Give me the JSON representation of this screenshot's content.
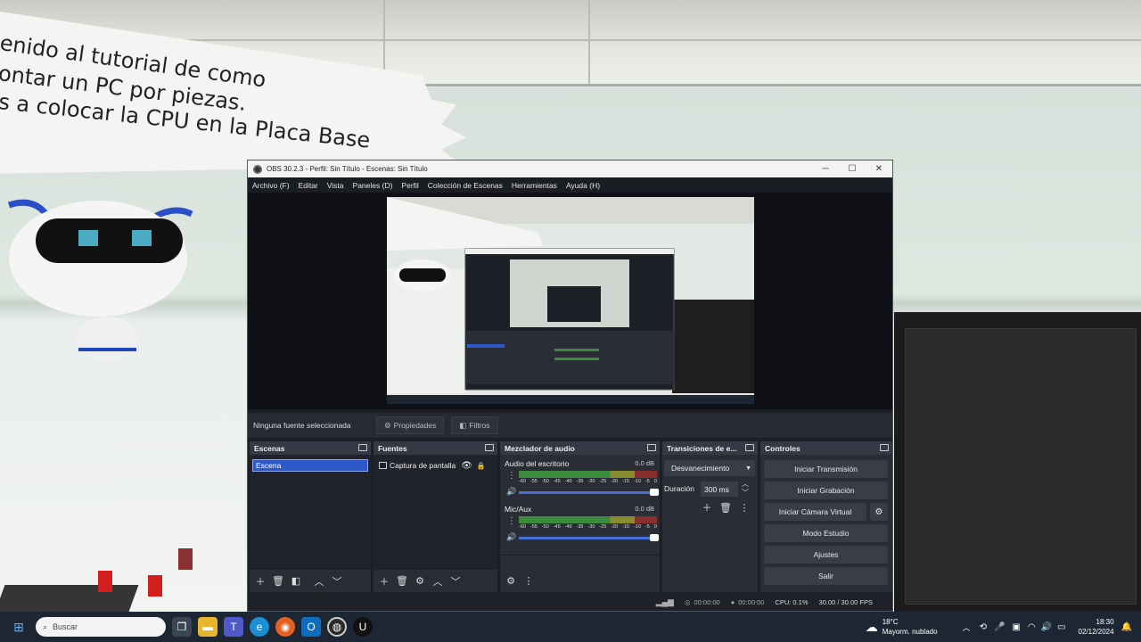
{
  "window": {
    "title": "OBS 30.2.3 - Perfil: Sin Título - Escenas: Sin Título"
  },
  "background": {
    "banner_lines": [
      "enido al tutorial de como",
      "ontar un PC por piezas.",
      "s a colocar la CPU en la Placa Base"
    ]
  },
  "menu": [
    "Archivo (F)",
    "Editar",
    "Vista",
    "Paneles (D)",
    "Perfil",
    "Colección de Escenas",
    "Herramientas",
    "Ayuda (H)"
  ],
  "source_bar": {
    "status": "Ninguna fuente seleccionada",
    "properties": "Propiedades",
    "filters": "Filtros"
  },
  "scenes": {
    "header": "Escenas",
    "items": [
      "Escena"
    ]
  },
  "sources": {
    "header": "Fuentes",
    "items": [
      "Captura de pantalla"
    ]
  },
  "mixer": {
    "header": "Mezclador de audio",
    "ticks": [
      "-60",
      "-55",
      "-50",
      "-45",
      "-40",
      "-35",
      "-30",
      "-25",
      "-20",
      "-15",
      "-10",
      "-5",
      "0"
    ],
    "channels": [
      {
        "name": "Audio del escritorio",
        "db": "0.0 dB"
      },
      {
        "name": "Mic/Aux",
        "db": "0.0 dB"
      }
    ]
  },
  "transitions": {
    "header": "Transiciones de e...",
    "selected": "Desvanecimiento",
    "duration_label": "Duración",
    "duration_value": "300 ms"
  },
  "controls": {
    "header": "Controles",
    "start_stream": "Iniciar Transmisión",
    "start_recording": "Iniciar Grabación",
    "start_virtual_cam": "Iniciar Cámara Virtual",
    "studio_mode": "Modo Estudio",
    "settings": "Ajustes",
    "exit": "Salir"
  },
  "status": {
    "stream_time": "00:00:00",
    "record_time": "00:00:00",
    "cpu": "CPU: 0.1%",
    "fps": "30.00 / 30.00 FPS"
  },
  "taskbar": {
    "search_placeholder": "Buscar",
    "weather_temp": "18°C",
    "weather_desc": "Mayorm. nublado",
    "time": "18:30",
    "date": "02/12/2024"
  },
  "colors": {
    "accent": "#2c59c7",
    "panel": "#2a2d36",
    "taskbar": "#1d2733"
  }
}
